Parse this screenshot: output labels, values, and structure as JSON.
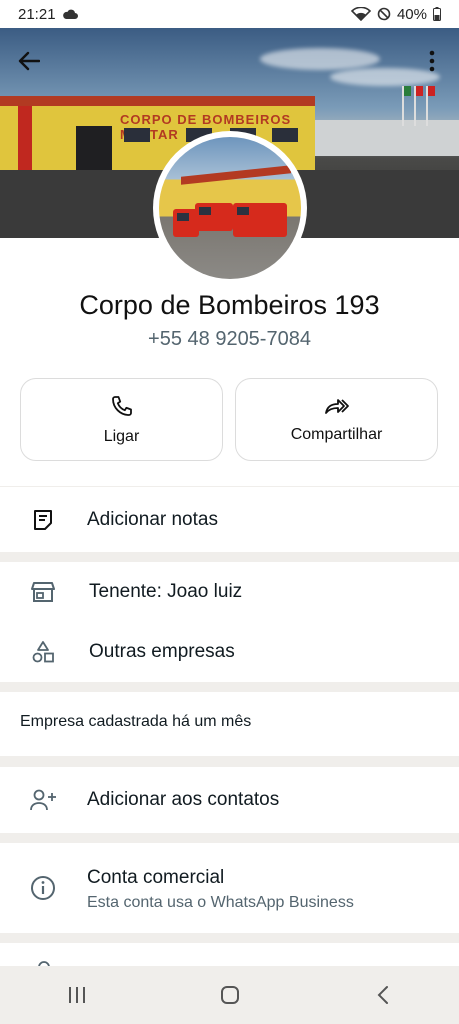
{
  "status_bar": {
    "time": "21:21",
    "battery": "40%"
  },
  "profile": {
    "name": "Corpo de Bombeiros 193",
    "phone": "+55 48 9205-7084",
    "cover_sign": "CORPO DE BOMBEIROS MILITAR"
  },
  "actions": [
    {
      "label": "Ligar",
      "icon": "phone-icon"
    },
    {
      "label": "Compartilhar",
      "icon": "share-icon"
    }
  ],
  "notes": {
    "label": "Adicionar notas",
    "icon": "notes-icon"
  },
  "business": {
    "owner": "Tenente: Joao luiz",
    "other": "Outras empresas"
  },
  "registered": "Empresa cadastrada há um mês",
  "contacts": {
    "label": "Adicionar aos contatos",
    "icon": "add-contact-icon"
  },
  "business_account": {
    "title": "Conta comercial",
    "subtitle": "Esta conta usa o WhatsApp Business",
    "icon": "info-icon"
  },
  "colors": {
    "background": "#f0eeeb",
    "text": "#111b21",
    "secondary": "#54656f"
  }
}
